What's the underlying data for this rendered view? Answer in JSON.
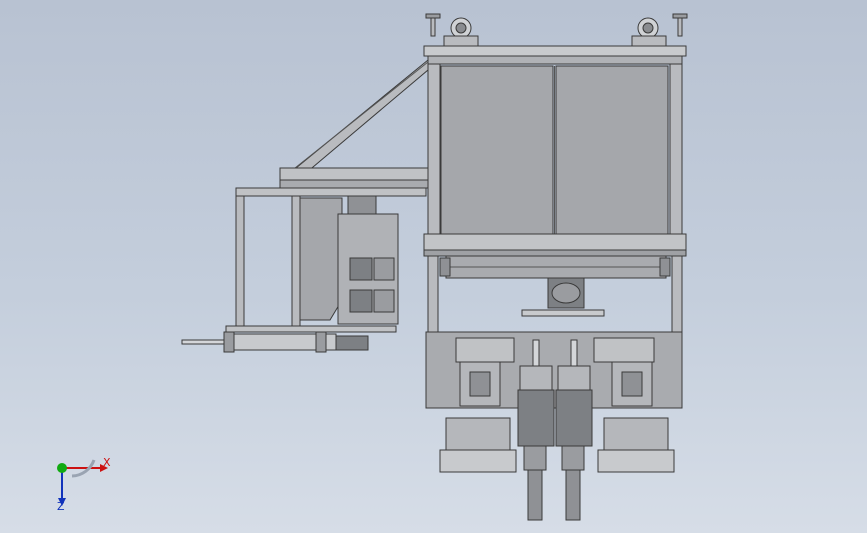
{
  "viewport": {
    "background_top": "#b8c2d2",
    "background_bottom": "#d6dde7"
  },
  "model": {
    "line_color": "#3a3a3a",
    "panel_fill": "#a5a7ab",
    "frame_fill": "#b9bbbf",
    "dark_fill": "#7d8084"
  },
  "triad": {
    "x_label": "X",
    "z_label": "Z",
    "x_color": "#cc1111",
    "y_color": "#11aa11",
    "z_color": "#1133bb"
  }
}
